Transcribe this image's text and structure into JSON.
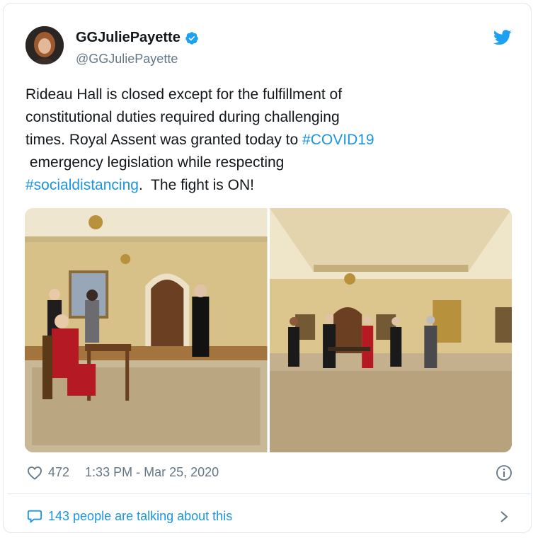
{
  "tweet": {
    "display_name": "GGJuliePayette",
    "handle": "@GGJuliePayette",
    "text_parts": {
      "p1": "Rideau Hall is closed except for the fulfillment of\nconstitutional duties required during challenging\ntimes. Royal Assent was granted today to ",
      "tag1": "#COVID19",
      "p2": "\n emergency legislation while respecting\n",
      "tag2": "#socialdistancing",
      "p3": ".  The fight is ON!"
    },
    "likes": "472",
    "timestamp": "1:33 PM - Mar 25, 2020",
    "talking": "143 people are talking about this"
  },
  "icons": {
    "verified": "verified-badge-icon",
    "brand": "twitter-bird-icon",
    "like": "heart-icon",
    "info": "info-icon",
    "reply": "speech-bubble-icon",
    "more": "chevron-right-icon"
  },
  "colors": {
    "link": "#1b95e0",
    "secondary_text": "#657786",
    "primary_text": "#14171a",
    "border": "#e1e8ed"
  }
}
